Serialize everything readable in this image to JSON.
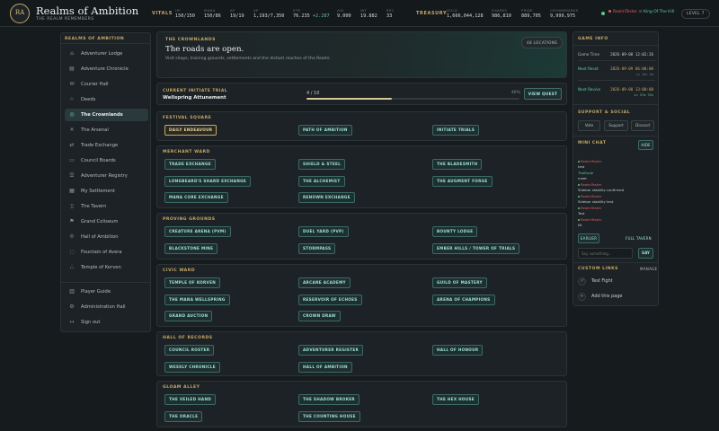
{
  "brand": {
    "logo_text": "RA",
    "title": "Realms of Ambition",
    "subtitle": "THE REALM REMEMBERS"
  },
  "vitals": {
    "label": "VITALS",
    "hp_label": "HP",
    "hp": "150/150",
    "mana_label": "MANA",
    "mana": "150/86",
    "ap_label": "AP",
    "ap": "19/19",
    "xp_label": "XP",
    "xp": "1,193/7,350",
    "str_label": "STR",
    "str": "76.235",
    "str_gain": "+2.287",
    "agi_label": "AGI",
    "agi": "9.000",
    "int_label": "INT",
    "int": "19.882",
    "rec_label": "REC",
    "rec": "33"
  },
  "treasury": {
    "label": "TREASURY",
    "gold_label": "GOLD",
    "gold": "1,666,044,128",
    "shares_label": "SHARES",
    "shares": "986,810",
    "pride_label": "PRIDE",
    "pride": "889,705",
    "crownmarks_label": "CROWNMARKS",
    "crownmarks": "9,999,975"
  },
  "user": {
    "name": "RealmTester",
    "at": "at",
    "realm": "King Of The Hill",
    "level": "LEVEL 7",
    "status_color": "#5fc28a",
    "alert_color": "#e06060"
  },
  "sidebar": {
    "title": "REALMS OF AMBITION",
    "items": [
      {
        "label": "Adventurer Lodge",
        "icon": "home-icon"
      },
      {
        "label": "Adventure Chronicle",
        "icon": "book-icon"
      },
      {
        "label": "Courier Hall",
        "icon": "envelope-icon"
      },
      {
        "label": "Deeds",
        "icon": "star-icon"
      },
      {
        "label": "The Crownlands",
        "icon": "compass-icon",
        "active": true
      },
      {
        "label": "The Arsenal",
        "icon": "swords-icon"
      },
      {
        "label": "Trade Exchange",
        "icon": "exchange-icon"
      },
      {
        "label": "Council Boards",
        "icon": "board-icon"
      },
      {
        "label": "Adventurer Registry",
        "icon": "registry-icon"
      },
      {
        "label": "My Settlement",
        "icon": "settlement-icon"
      },
      {
        "label": "The Tavern",
        "icon": "mug-icon"
      },
      {
        "label": "Grand Coliseum",
        "icon": "flag-icon"
      },
      {
        "label": "Hall of Ambition",
        "icon": "trophy-icon"
      },
      {
        "label": "Fountain of Avera",
        "icon": "fountain-icon"
      },
      {
        "label": "Temple of Korven",
        "icon": "temple-icon"
      }
    ],
    "footer": [
      {
        "label": "Player Guide",
        "icon": "guide-icon"
      },
      {
        "label": "Administration Hall",
        "icon": "gear-icon"
      },
      {
        "label": "Sign out",
        "icon": "signout-icon"
      }
    ]
  },
  "hero": {
    "kicker": "THE CROWNLANDS",
    "title": "The roads are open.",
    "subtitle": "Visit shops, training grounds, settlements and the distant reaches of the Realm.",
    "locations_button": "48 LOCATIONS"
  },
  "quest": {
    "kicker": "CURRENT INITIATE TRIAL",
    "name": "Wellspring Attunement",
    "count": "4 / 10",
    "percent": "40%",
    "progress": 0.4,
    "button": "VIEW QUEST"
  },
  "sections": [
    {
      "title": "FESTIVAL SQUARE",
      "locations": [
        "DAILY ENDEAVOUR",
        "PATH OF AMBITION",
        "INITIATE TRIALS"
      ]
    },
    {
      "title": "MERCHANT WARD",
      "locations": [
        "TRADE EXCHANGE",
        "SHIELD & STEEL",
        "THE BLADESMITH",
        "LONGBEARD'S SHARD EXCHANGE",
        "THE ALCHEMIST",
        "THE AUGMENT FORGE",
        "MANA CORE EXCHANGE",
        "RENOWN EXCHANGE"
      ]
    },
    {
      "title": "PROVING GROUNDS",
      "locations": [
        "CREATURE ARENA (PVM)",
        "DUEL YARD (PVP)",
        "BOUNTY LODGE",
        "BLACKSTONE MINE",
        "STORMPASS",
        "EMBER HILLS / TOWER OF TRIALS"
      ]
    },
    {
      "title": "CIVIC WARD",
      "locations": [
        "TEMPLE OF KORVEN",
        "ARCANE ACADEMY",
        "GUILD OF MASTERY",
        "THE MANA WELLSPRING",
        "RESERVOIR OF ECHOES",
        "ARENA OF CHAMPIONS",
        "GRAND AUCTION",
        "CROWN DRAW"
      ]
    },
    {
      "title": "HALL OF RECORDS",
      "locations": [
        "COUNCIL ROSTER",
        "ADVENTURER REGISTER",
        "HALL OF HONOUR",
        "WEEKLY CHRONICLE",
        "HALL OF AMBITION"
      ]
    },
    {
      "title": "GLOAM ALLEY",
      "locations": [
        "THE VEILED HAND",
        "THE SHADOW BROKER",
        "THE HEX HOUSE",
        "THE ORACLE",
        "THE COUNTING HOUSE"
      ]
    }
  ],
  "game_info": {
    "title": "GAME INFO",
    "game_time_label": "Game Time",
    "game_time": "2026-09-08 12:02:26",
    "next_reset_label": "Next Reset",
    "next_reset": "2026-09-09 06:00:00",
    "next_reset_rel": "in 16h 5m",
    "next_revive_label": "Next Revive",
    "next_revive": "2026-09-08 13:00:00",
    "next_revive_rel": "in 57m 33s"
  },
  "support": {
    "title": "SUPPORT & SOCIAL",
    "vote": "Vote",
    "support": "Support",
    "discord": "Discord"
  },
  "chat": {
    "title": "MINI CHAT",
    "hide": "HIDE",
    "messages": [
      {
        "name": "RealmTester",
        "text": "test"
      },
      {
        "name": "TheDude",
        "text": "meet"
      },
      {
        "name": "RealmTester",
        "text": "Sidebar stability confirmed"
      },
      {
        "name": "RealmTester",
        "text": "Sidebar stability test"
      },
      {
        "name": "RealmTester",
        "text": "Test"
      },
      {
        "name": "RealmTester",
        "text": "ttt"
      }
    ],
    "earlier": "EARLIER",
    "full_tavern": "FULL TAVERN",
    "placeholder": "Say something...",
    "say": "SAY"
  },
  "custom_links": {
    "title": "CUSTOM LINKS",
    "manage": "MANAGE",
    "items": [
      {
        "label": "Test Fight",
        "icon": "link-icon"
      },
      {
        "label": "Add this page",
        "icon": "plus-icon"
      }
    ]
  }
}
